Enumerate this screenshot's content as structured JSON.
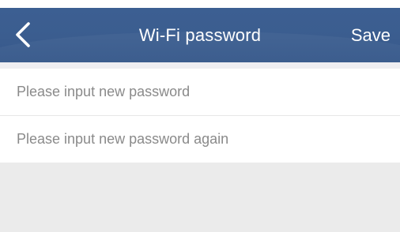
{
  "header": {
    "title": "Wi-Fi password",
    "save_label": "Save",
    "back_icon": "chevron-left-icon",
    "background_color": "#3b5d8f",
    "text_color": "#ffffff"
  },
  "form": {
    "new_password": {
      "placeholder": "Please input new password",
      "value": ""
    },
    "confirm_password": {
      "placeholder": "Please input new password again",
      "value": ""
    }
  }
}
